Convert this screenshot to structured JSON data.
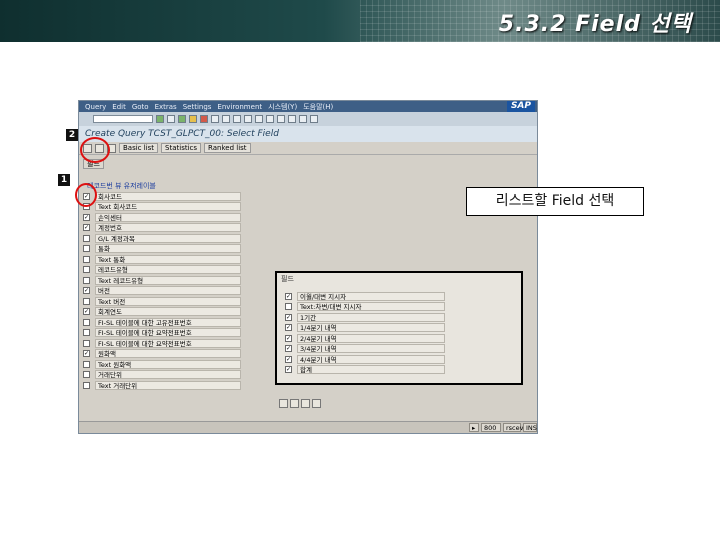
{
  "slide": {
    "title": "5.3.2 Field 선택"
  },
  "sap": {
    "menu": [
      "Query",
      "Edit",
      "Goto",
      "Extras",
      "Settings",
      "Environment",
      "시스템(Y)",
      "도움말(H)"
    ],
    "logo": "SAP",
    "screen_title": "Create Query TCST_GLPCT_00: Select Field",
    "toolbar_buttons": [
      "Basic list",
      "Statistics",
      "Ranked list"
    ],
    "small_tab": "필드",
    "tree_header": "레코드번 뷰 유저레이블",
    "fields": [
      {
        "label": "회사코드",
        "checked": true
      },
      {
        "label": "Text 회사코드",
        "checked": false
      },
      {
        "label": "손익센터",
        "checked": true
      },
      {
        "label": "계정번호",
        "checked": true
      },
      {
        "label": "G/L 계정과목",
        "checked": false
      },
      {
        "label": "통화",
        "checked": false
      },
      {
        "label": "Text 통화",
        "checked": false
      },
      {
        "label": "레코드유형",
        "checked": false
      },
      {
        "label": "Text 레코드유형",
        "checked": false
      },
      {
        "label": "버전",
        "checked": true
      },
      {
        "label": "Text 버전",
        "checked": false
      },
      {
        "label": "회계연도",
        "checked": true
      },
      {
        "label": "FI-SL 테이블에 대한 고유전표번호",
        "checked": false
      },
      {
        "label": "FI-SL 테이블에 대한 요약전표번호",
        "checked": false
      },
      {
        "label": "FI-SL 테이블에 대한 요약전표번호",
        "checked": false
      },
      {
        "label": "원화액",
        "checked": true
      },
      {
        "label": "Text 원화액",
        "checked": false
      },
      {
        "label": "거래단위",
        "checked": false
      },
      {
        "label": "Text 거래단위",
        "checked": false
      }
    ],
    "right_panel": {
      "header": "필드",
      "fields": [
        {
          "label": "이월/대변 지시자",
          "checked": true
        },
        {
          "label": "Text:차변/대변 지시자",
          "checked": false
        },
        {
          "label": "1기간",
          "checked": true
        },
        {
          "label": "1/4분기 내역",
          "checked": true
        },
        {
          "label": "2/4분기 내역",
          "checked": true
        },
        {
          "label": "3/4분기 내역",
          "checked": true
        },
        {
          "label": "4/4분기 내역",
          "checked": true
        },
        {
          "label": "합계",
          "checked": true
        }
      ]
    },
    "status": {
      "client": "800",
      "server": "rscev",
      "mode": "INS"
    }
  },
  "callout": {
    "text": "리스트할 Field 선택"
  },
  "markers": {
    "one": "1",
    "two": "2"
  }
}
